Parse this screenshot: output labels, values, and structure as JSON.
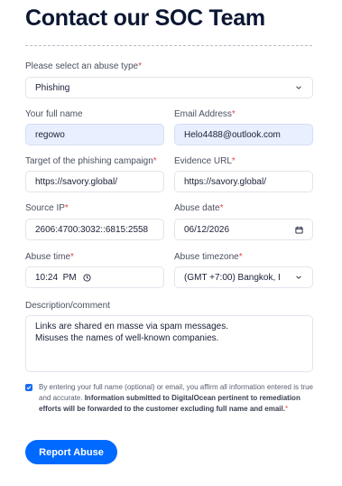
{
  "page": {
    "title": "Contact our SOC Team"
  },
  "form": {
    "abuse_type": {
      "label": "Please select an abuse type",
      "required": "*",
      "value": "Phishing"
    },
    "full_name": {
      "label": "Your full name",
      "value": "regowo"
    },
    "email": {
      "label": "Email Address",
      "required": "*",
      "value": "Helo4488@outlook.com"
    },
    "target": {
      "label": "Target of the phishing campaign",
      "required": "*",
      "value": "https://savory.global/"
    },
    "evidence_url": {
      "label": "Evidence URL",
      "required": "*",
      "value": "https://savory.global/"
    },
    "source_ip": {
      "label": "Source IP",
      "required": "*",
      "value": "2606:4700:3032::6815:2558"
    },
    "abuse_date": {
      "label": "Abuse date",
      "required": "*",
      "value": "06/12/2026"
    },
    "abuse_time": {
      "label": "Abuse time",
      "required": "*",
      "value": "10:24  PM"
    },
    "abuse_timezone": {
      "label": "Abuse timezone",
      "required": "*",
      "value": "(GMT +7:00) Bangkok, I"
    },
    "description": {
      "label": "Description/comment",
      "line1": "Links are shared en masse via spam messages.",
      "line2": "Misuses the names of well-known companies."
    },
    "consent": {
      "checked": true,
      "text_plain": "By entering your full name (optional) or email, you affirm all information entered is true and accurate. ",
      "text_bold": "Information submitted to DigitalOcean pertinent to remediation efforts will be forwarded to the customer excluding full name and email.",
      "required": "*"
    },
    "submit_label": "Report Abuse"
  },
  "colors": {
    "accent": "#0069ff",
    "required": "#e5484d",
    "filled_field": "#e8efff"
  },
  "icons": {
    "dropdown": "chevron-down-icon",
    "calendar": "calendar-icon",
    "clock": "clock-icon",
    "checkbox": "check-icon"
  }
}
